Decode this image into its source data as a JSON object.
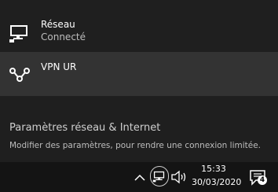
{
  "flyout": {
    "networks": [
      {
        "name": "Réseau",
        "status": "Connecté",
        "icon": "ethernet-network-icon"
      },
      {
        "name": "VPN UR",
        "icon": "vpn-icon"
      }
    ],
    "settings_link": "Paramètres réseau & Internet",
    "settings_desc": "Modifier des paramètres, pour rendre une connexion limitée."
  },
  "taskbar": {
    "time": "15:33",
    "date": "30/03/2020",
    "notification_count": "4",
    "icons": [
      "chevron-up-icon",
      "network-icon",
      "volume-icon",
      "action-center-icon"
    ]
  },
  "colors": {
    "flyout_bg": "#1f1f1f",
    "selected_bg": "#333333",
    "taskbar_bg": "#141414"
  }
}
